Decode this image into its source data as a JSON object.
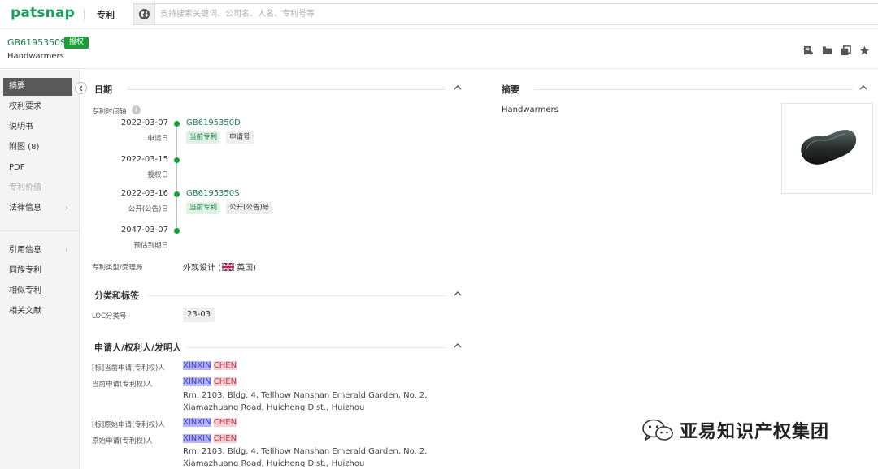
{
  "app": {
    "logo": "patsnap",
    "nav_label": "专利",
    "search_placeholder": "支持搜索关键词、公司名、人名、专利号等"
  },
  "header": {
    "patent_number": "GB6195350S",
    "status_badge": "授权",
    "title": "Handwarmers"
  },
  "sidebar": {
    "items": [
      {
        "label": "摘要"
      },
      {
        "label": "权利要求"
      },
      {
        "label": "说明书"
      },
      {
        "label": "附图 (8)"
      },
      {
        "label": "PDF"
      },
      {
        "label": "专利价值"
      },
      {
        "label": "法律信息"
      },
      {
        "label": "引用信息"
      },
      {
        "label": "同族专利"
      },
      {
        "label": "相似专利"
      },
      {
        "label": "相关文献"
      }
    ]
  },
  "dates": {
    "section_title": "日期",
    "timeline_label": "专利时间轴",
    "timeline": [
      {
        "date": "2022-03-07",
        "label": "申请日",
        "number": "GB6195350D",
        "tags": [
          "当前专利",
          "申请号"
        ]
      },
      {
        "date": "2022-03-15",
        "label": "授权日",
        "number": "",
        "tags": []
      },
      {
        "date": "2022-03-16",
        "label": "公开(公告)日",
        "number": "GB6195350S",
        "tags": [
          "当前专利",
          "公开(公告)号"
        ]
      },
      {
        "date": "2047-03-07",
        "label": "预估到期日",
        "number": "",
        "tags": []
      }
    ],
    "type_label": "专利类型/受理局",
    "type_value": "外观设计 (",
    "country": "英国)"
  },
  "classification": {
    "section_title": "分类和标签",
    "loc_label": "LOC分类号",
    "loc_value": "23-03"
  },
  "parties": {
    "section_title": "申请人/权利人/发明人",
    "rows": [
      {
        "label": "[标]当前申请(专利权)人",
        "first": "XINXIN",
        "last": "CHEN",
        "address": ""
      },
      {
        "label": "当前申请(专利权)人",
        "first": "XINXIN",
        "last": "CHEN",
        "address": "Rm. 2103, Bldg. 4, Tellhow Nanshan Emerald Garden, No. 2, Xiamazhuang Road, Huicheng Dist., Huizhou"
      },
      {
        "label": "[标]原始申请(专利权)人",
        "first": "XINXIN",
        "last": "CHEN",
        "address": ""
      },
      {
        "label": "原始申请(专利权)人",
        "first": "XINXIN",
        "last": "CHEN",
        "address": "Rm. 2103, Bldg. 4, Tellhow Nanshan Emerald Garden, No. 2, Xiamazhuang Road, Huicheng Dist., Huizhou"
      }
    ]
  },
  "abstract": {
    "section_title": "摘要",
    "text": "Handwarmers"
  },
  "watermark": {
    "text": "亚易知识产权集团"
  },
  "colors": {
    "brand": "#1a9e60",
    "granted": "#1a9e3a",
    "sidebar_active": "#595959"
  }
}
